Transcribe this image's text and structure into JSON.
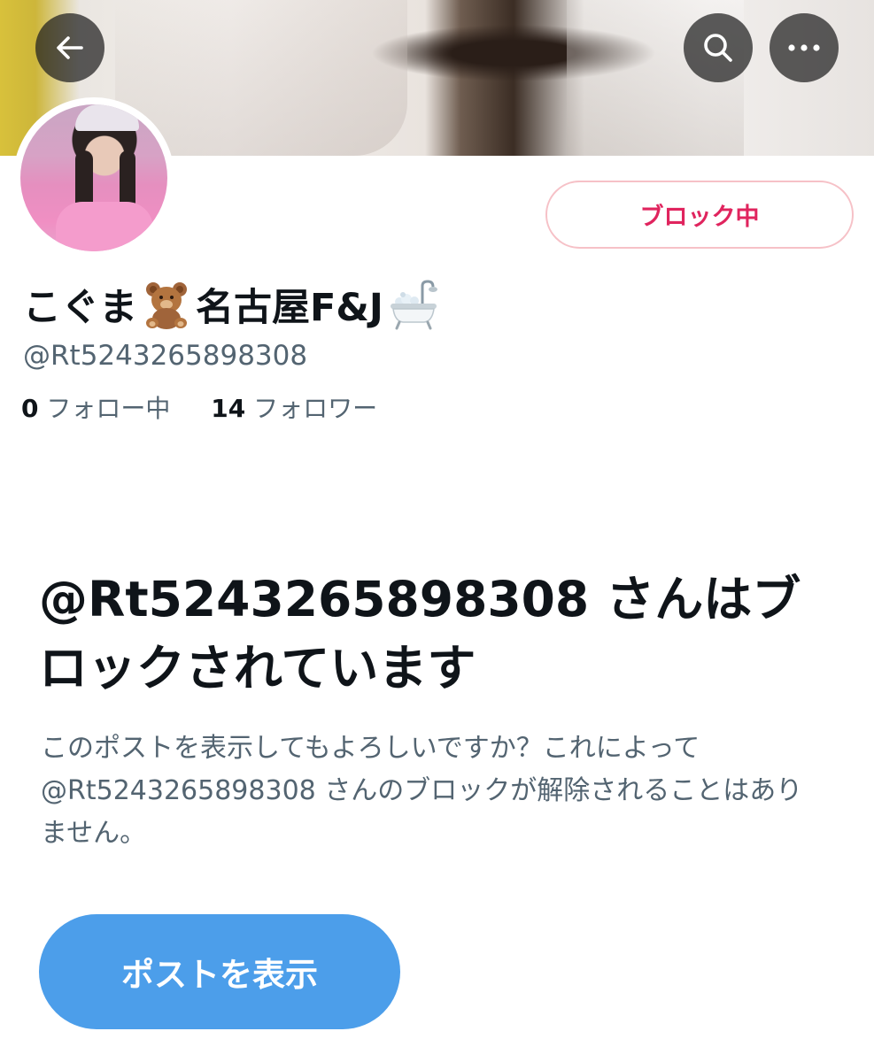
{
  "header": {
    "back_icon": "arrow-left-icon",
    "search_icon": "search-icon",
    "more_icon": "more-horizontal-icon"
  },
  "profile": {
    "name_part1": "こぐま",
    "name_emoji1": "teddy-bear-icon",
    "name_part2": "名古屋F&J",
    "name_emoji2": "bathtub-icon",
    "handle": "@Rt5243265898308",
    "following_count": "0",
    "following_label": "フォロー中",
    "followers_count": "14",
    "followers_label": "フォロワー",
    "block_status_label": "ブロック中"
  },
  "notice": {
    "headline": "@Rt5243265898308 さんはブロックされています",
    "description": "このポストを表示してもよろしいですか？これによって@Rt5243265898308 さんのブロックが解除されることはありません。",
    "view_button_label": "ポストを表示"
  },
  "colors": {
    "accent_blue": "#4c9eea",
    "block_red": "#e0245e",
    "secondary_text": "#536471"
  }
}
